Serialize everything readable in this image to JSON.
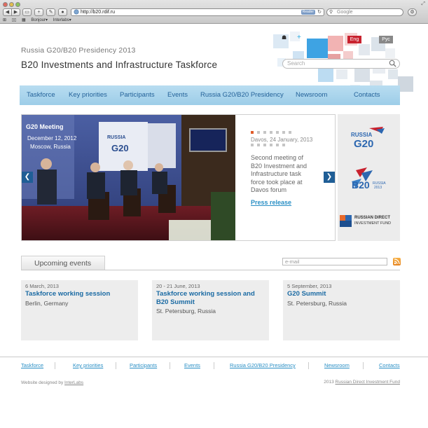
{
  "browser": {
    "window_title": "",
    "url": "http://b20.rdif.ru",
    "reader_label": "Reader",
    "search_placeholder": "Google",
    "bookmarks": [
      "Bonjour▾",
      "Interlabs▾"
    ]
  },
  "header": {
    "subtitle": "Russia G20/B20 Presidency 2013",
    "title": "B20 Investments and Infrastructure Taskforce",
    "lang_en": "Eng",
    "lang_ru": "Рус",
    "search_placeholder": "Search"
  },
  "nav": {
    "items": [
      {
        "label": "Taskforce"
      },
      {
        "label": "Key priorities"
      },
      {
        "label": "Participants"
      },
      {
        "label": "Events"
      },
      {
        "label": "Russia G20/B20 Presidency"
      },
      {
        "label": "Newsroom"
      },
      {
        "label": "Contacts"
      }
    ]
  },
  "slider": {
    "photo_banner_1": "G20 Meeting",
    "photo_banner_2": "December 12, 2012",
    "photo_banner_3": "Moscow, Russia",
    "photo_banner_4": "RUSSIA",
    "photo_banner_5": "G20",
    "date": "Davos, 24 January, 2013",
    "description": "Second meeting of B20 Investment and Infrastructure task force took place at Davos forum",
    "link_label": "Press release",
    "dot_count": 13,
    "active_dot": 0
  },
  "partners": {
    "russia_text": "RUSSIA",
    "g20_text": "G20",
    "b20_text": "B20",
    "b20_sub1": "RUSSIA",
    "b20_sub2": "2013",
    "rdif_line1": "RUSSIAN DIRECT",
    "rdif_line2": "INVESTMENT FUND"
  },
  "events": {
    "tab_label": "Upcoming events",
    "email_placeholder": "e-mail",
    "items": [
      {
        "date": "6 March, 2013",
        "title": "Taskforce working session",
        "place": "Berlin, Germany"
      },
      {
        "date": "20 - 21 June, 2013",
        "title": "Taskforce working session and B20 Summit",
        "place": "St. Petersburg, Russia"
      },
      {
        "date": "5 September, 2013",
        "title": "G20 Summit",
        "place": "St. Petersburg, Russia"
      }
    ]
  },
  "footer": {
    "nav": [
      "Taskforce",
      "Key priorities",
      "Participants",
      "Events",
      "Russia G20/B20 Presidency",
      "Newsroom",
      "Contacts"
    ],
    "designed_prefix": "Website designed by ",
    "designed_link": "InterLabs",
    "copyright_prefix": "2013 ",
    "copyright_link": "Russian Direct Investment Fund"
  },
  "colors": {
    "nav_bg": "#a9d5ec",
    "nav_text": "#25639a",
    "link": "#2a8fc5",
    "event_title": "#1a6aa3",
    "lang_en_bg": "#c8212e",
    "arrow_bg": "#1f5e96",
    "dot_active": "#e05c2a"
  }
}
